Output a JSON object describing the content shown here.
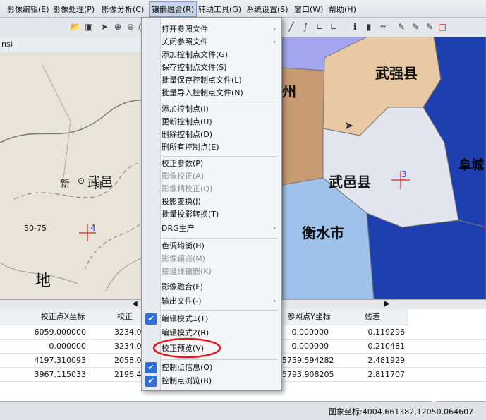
{
  "menubar": {
    "items": [
      {
        "label": "影像编辑(E)"
      },
      {
        "label": "影像处理(P)"
      },
      {
        "label": "影像分析(C)"
      },
      {
        "label": "镶嵌融合(R)"
      },
      {
        "label": "辅助工具(G)"
      },
      {
        "label": "系统设置(S)"
      },
      {
        "label": "窗口(W)"
      },
      {
        "label": "帮助(H)"
      }
    ]
  },
  "left_panel": {
    "title": "nsi"
  },
  "left_map": {
    "labels": {
      "town": "武邑",
      "xin": "新",
      "pai": "排",
      "range": "50-75",
      "di": "地",
      "marker": "4"
    }
  },
  "right_map": {
    "labels": {
      "wuqiang": "武强县",
      "wuyi": "武邑县",
      "hengshui": "衡水市",
      "fucheng": "阜城",
      "zhou": "州",
      "marker": "3"
    },
    "colors": {
      "wuqiang": "#e8c9a4",
      "wuyi": "#e2e5ee",
      "hengshui": "#9ec2ea",
      "west": "#c89a72",
      "east": "#1d3fb0",
      "top": "#a3a6ee"
    }
  },
  "dropdown": {
    "items": [
      {
        "label": "打开参照文件",
        "submenu": "›"
      },
      {
        "label": "关闭参照文件",
        "submenu": "›"
      },
      {
        "label": "添加控制点文件(G)"
      },
      {
        "label": "保存控制点文件(S)"
      },
      {
        "label": "批量保存控制点文件(L)"
      },
      {
        "label": "批量导入控制点文件(N)"
      },
      {
        "label": "添加控制点(I)"
      },
      {
        "label": "更新控制点(U)"
      },
      {
        "label": "删除控制点(D)"
      },
      {
        "label": "删所有控制点(E)"
      },
      {
        "label": "校正参数(P)"
      },
      {
        "label": "影像校正(A)"
      },
      {
        "label": "影像精校正(Q)"
      },
      {
        "label": "投影变换(J)"
      },
      {
        "label": "批量投影转换(T)"
      },
      {
        "label": "DRG生产",
        "submenu": "›"
      },
      {
        "label": "色调均衡(H)"
      },
      {
        "label": "影像镶嵌(M)"
      },
      {
        "label": "接缝线镶嵌(K)"
      },
      {
        "label": "影像融合(F)"
      },
      {
        "label": "输出文件(-)",
        "submenu": "›"
      },
      {
        "label": "编辑模式1(T)",
        "check": "✔"
      },
      {
        "label": "编辑模式2(R)"
      },
      {
        "label": "校正预览(V)"
      },
      {
        "label": "控制点信息(O)",
        "check": "✔"
      },
      {
        "label": "控制点浏览(B)",
        "check": "✔"
      }
    ]
  },
  "grid": {
    "headers": [
      "校正点X坐标",
      "校正",
      "参照点Y坐标",
      "残差"
    ],
    "rows": [
      {
        "x": "6059.000000",
        "c": "3234.0",
        "ref_y": "0.000000",
        "res": "0.119296"
      },
      {
        "x": "0.000000",
        "c": "3234.0",
        "ref_y": "0.000000",
        "res": "0.210481"
      },
      {
        "x": "4197.310093",
        "c": "2058.0",
        "ref_y": "5759.594282",
        "res": "2.481929"
      },
      {
        "x": "3967.115033",
        "c": "2196.4",
        "ref_y": "5793.908205",
        "res": "2.811707"
      }
    ]
  },
  "statusbar": {
    "coords": "图象坐标:4004.661382,12050.064607",
    "watermark": "CSDN @WISDOM_x"
  }
}
